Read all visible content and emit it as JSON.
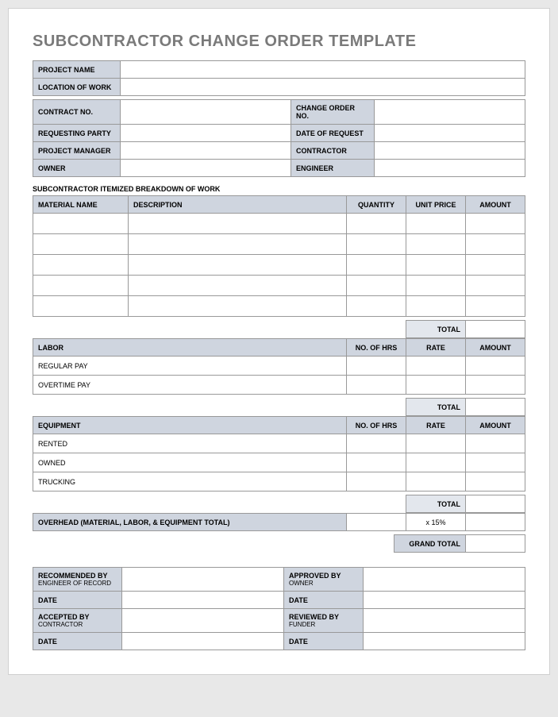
{
  "title": "SUBCONTRACTOR CHANGE ORDER TEMPLATE",
  "info": {
    "project_name_label": "PROJECT NAME",
    "project_name": "",
    "location_label": "LOCATION OF WORK",
    "location": "",
    "contract_no_label": "CONTRACT NO.",
    "contract_no": "",
    "change_order_no_label": "CHANGE ORDER NO.",
    "change_order_no": "",
    "requesting_party_label": "REQUESTING PARTY",
    "requesting_party": "",
    "date_request_label": "DATE OF REQUEST",
    "date_request": "",
    "project_manager_label": "PROJECT MANAGER",
    "project_manager": "",
    "contractor_label": "CONTRACTOR",
    "contractor": "",
    "owner_label": "OWNER",
    "owner": "",
    "engineer_label": "ENGINEER",
    "engineer": ""
  },
  "breakdown_heading": "SUBCONTRACTOR ITEMIZED BREAKDOWN OF WORK",
  "materials": {
    "cols": {
      "name": "MATERIAL NAME",
      "desc": "DESCRIPTION",
      "qty": "QUANTITY",
      "unit": "UNIT PRICE",
      "amount": "AMOUNT"
    },
    "rows": [
      {
        "name": "",
        "desc": "",
        "qty": "",
        "unit": "",
        "amount": ""
      },
      {
        "name": "",
        "desc": "",
        "qty": "",
        "unit": "",
        "amount": ""
      },
      {
        "name": "",
        "desc": "",
        "qty": "",
        "unit": "",
        "amount": ""
      },
      {
        "name": "",
        "desc": "",
        "qty": "",
        "unit": "",
        "amount": ""
      },
      {
        "name": "",
        "desc": "",
        "qty": "",
        "unit": "",
        "amount": ""
      }
    ],
    "total_label": "TOTAL",
    "total": ""
  },
  "labor": {
    "cols": {
      "labor": "LABOR",
      "hrs": "NO. OF HRS",
      "rate": "RATE",
      "amount": "AMOUNT"
    },
    "rows": [
      {
        "name": "REGULAR PAY",
        "hrs": "",
        "rate": "",
        "amount": ""
      },
      {
        "name": "OVERTIME PAY",
        "hrs": "",
        "rate": "",
        "amount": ""
      }
    ],
    "total_label": "TOTAL",
    "total": ""
  },
  "equipment": {
    "cols": {
      "equip": "EQUIPMENT",
      "hrs": "NO. OF HRS",
      "rate": "RATE",
      "amount": "AMOUNT"
    },
    "rows": [
      {
        "name": "RENTED",
        "hrs": "",
        "rate": "",
        "amount": ""
      },
      {
        "name": "OWNED",
        "hrs": "",
        "rate": "",
        "amount": ""
      },
      {
        "name": "TRUCKING",
        "hrs": "",
        "rate": "",
        "amount": ""
      }
    ],
    "total_label": "TOTAL",
    "total": ""
  },
  "overhead": {
    "label": "OVERHEAD (MATERIAL, LABOR, & EQUIPMENT TOTAL)",
    "blank1": "",
    "pct": "x 15%",
    "amount": "",
    "grand_total_label": "GRAND TOTAL",
    "grand_total": ""
  },
  "sign": {
    "recommended_label": "RECOMMENDED BY",
    "recommended_sub": "ENGINEER OF RECORD",
    "recommended": "",
    "approved_label": "APPROVED BY",
    "approved_sub": "OWNER",
    "approved": "",
    "date_label": "DATE",
    "date1": "",
    "date2": "",
    "accepted_label": "ACCEPTED BY",
    "accepted_sub": "CONTRACTOR",
    "accepted": "",
    "reviewed_label": "REVIEWED BY",
    "reviewed_sub": "FUNDER",
    "reviewed": "",
    "date3": "",
    "date4": ""
  }
}
